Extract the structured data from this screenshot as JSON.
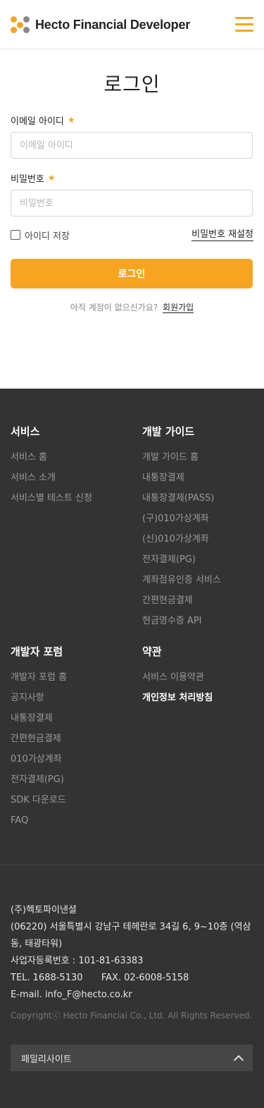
{
  "header": {
    "brand": "Hecto Financial Developer",
    "colors": {
      "accent": "#f5a623"
    }
  },
  "login": {
    "title": "로그인",
    "email_label": "이메일 아이디",
    "email_placeholder": "이메일 아이디",
    "password_label": "비밀번호",
    "password_placeholder": "비밀번호",
    "required_mark": "★",
    "remember_label": "아이디 저장",
    "reset_link": "비밀번호 재설정",
    "submit_label": "로그인",
    "signup_prompt": "아직 계정이 없으신가요?",
    "signup_link": "회원가입"
  },
  "footer": {
    "services": {
      "title": "서비스",
      "items": [
        "서비스 홈",
        "서비스 소개",
        "서비스별 테스트 신청"
      ]
    },
    "guide": {
      "title": "개발 가이드",
      "items": [
        "개발 가이드 홈",
        "내통장결제",
        "내통장결제(PASS)",
        "(구)010가상계좌",
        "(신)010가상계좌",
        "전자결제(PG)",
        "계좌점유인증 서비스",
        "간편현금결제",
        "현금영수증 API"
      ]
    },
    "forum": {
      "title": "개발자 포럼",
      "items": [
        "개발자 포럼 홈",
        "공지사항",
        "내통장결제",
        "간편현금결제",
        "010가상계좌",
        "전자결제(PG)",
        "SDK 다운로드",
        "FAQ"
      ]
    },
    "terms": {
      "title": "약관",
      "items": [
        "서비스 이용약관",
        "개인정보 처리방침"
      ]
    },
    "company": {
      "name": "(주)헥토파이낸셜",
      "address": "(06220) 서울특별시 강남구 테헤란로 34길 6, 9~10층 (역삼동, 태광타워)",
      "biz_no": "사업자등록번호 : 101-81-63383",
      "tel": "TEL. 1688-5130",
      "fax": "FAX. 02-6008-5158",
      "email": "E-mail. info_F@hecto.co.kr"
    },
    "copyright": "Copyrightⓒ Hecto Financial Co., Ltd. All Rights Reserved.",
    "family_site": "패밀리사이트"
  }
}
